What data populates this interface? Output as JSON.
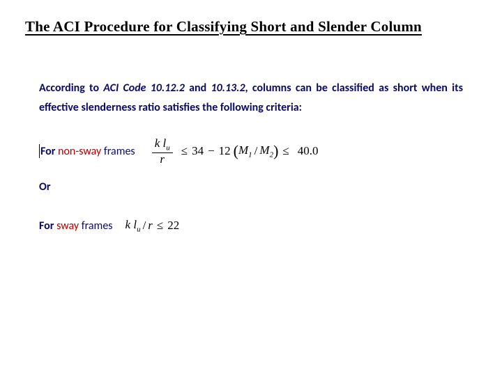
{
  "title": "The ACI Procedure for Classifying Short and Slender Column",
  "paragraph": {
    "lead": "According to ",
    "code_ref": "ACI Code 10.12.2",
    "mid": " and ",
    "code_ref2": "10.13.2",
    "tail": ", columns can be classified as short when its effective slenderness ratio satisfies the following criteria:"
  },
  "nonsway": {
    "for": "For",
    "type": "non-sway",
    "frames": "frames",
    "frac_num": "k l",
    "frac_num_sub": "u",
    "frac_den": "r",
    "le1": "≤",
    "c1": "34",
    "minus": "−",
    "c2": "12",
    "lp": "(",
    "m1": "M",
    "m1_sub": "1",
    "slash": "/",
    "m2": "M",
    "m2_sub": "2",
    "rp": ")",
    "le2": "≤",
    "c3": "40.0"
  },
  "or_label": "Or",
  "sway": {
    "for": "For",
    "type": "sway",
    "frames": "frames",
    "expr_k": "k l",
    "expr_sub": "u",
    "expr_slash": "/",
    "expr_r": "r",
    "le": "≤",
    "limit": "22"
  }
}
